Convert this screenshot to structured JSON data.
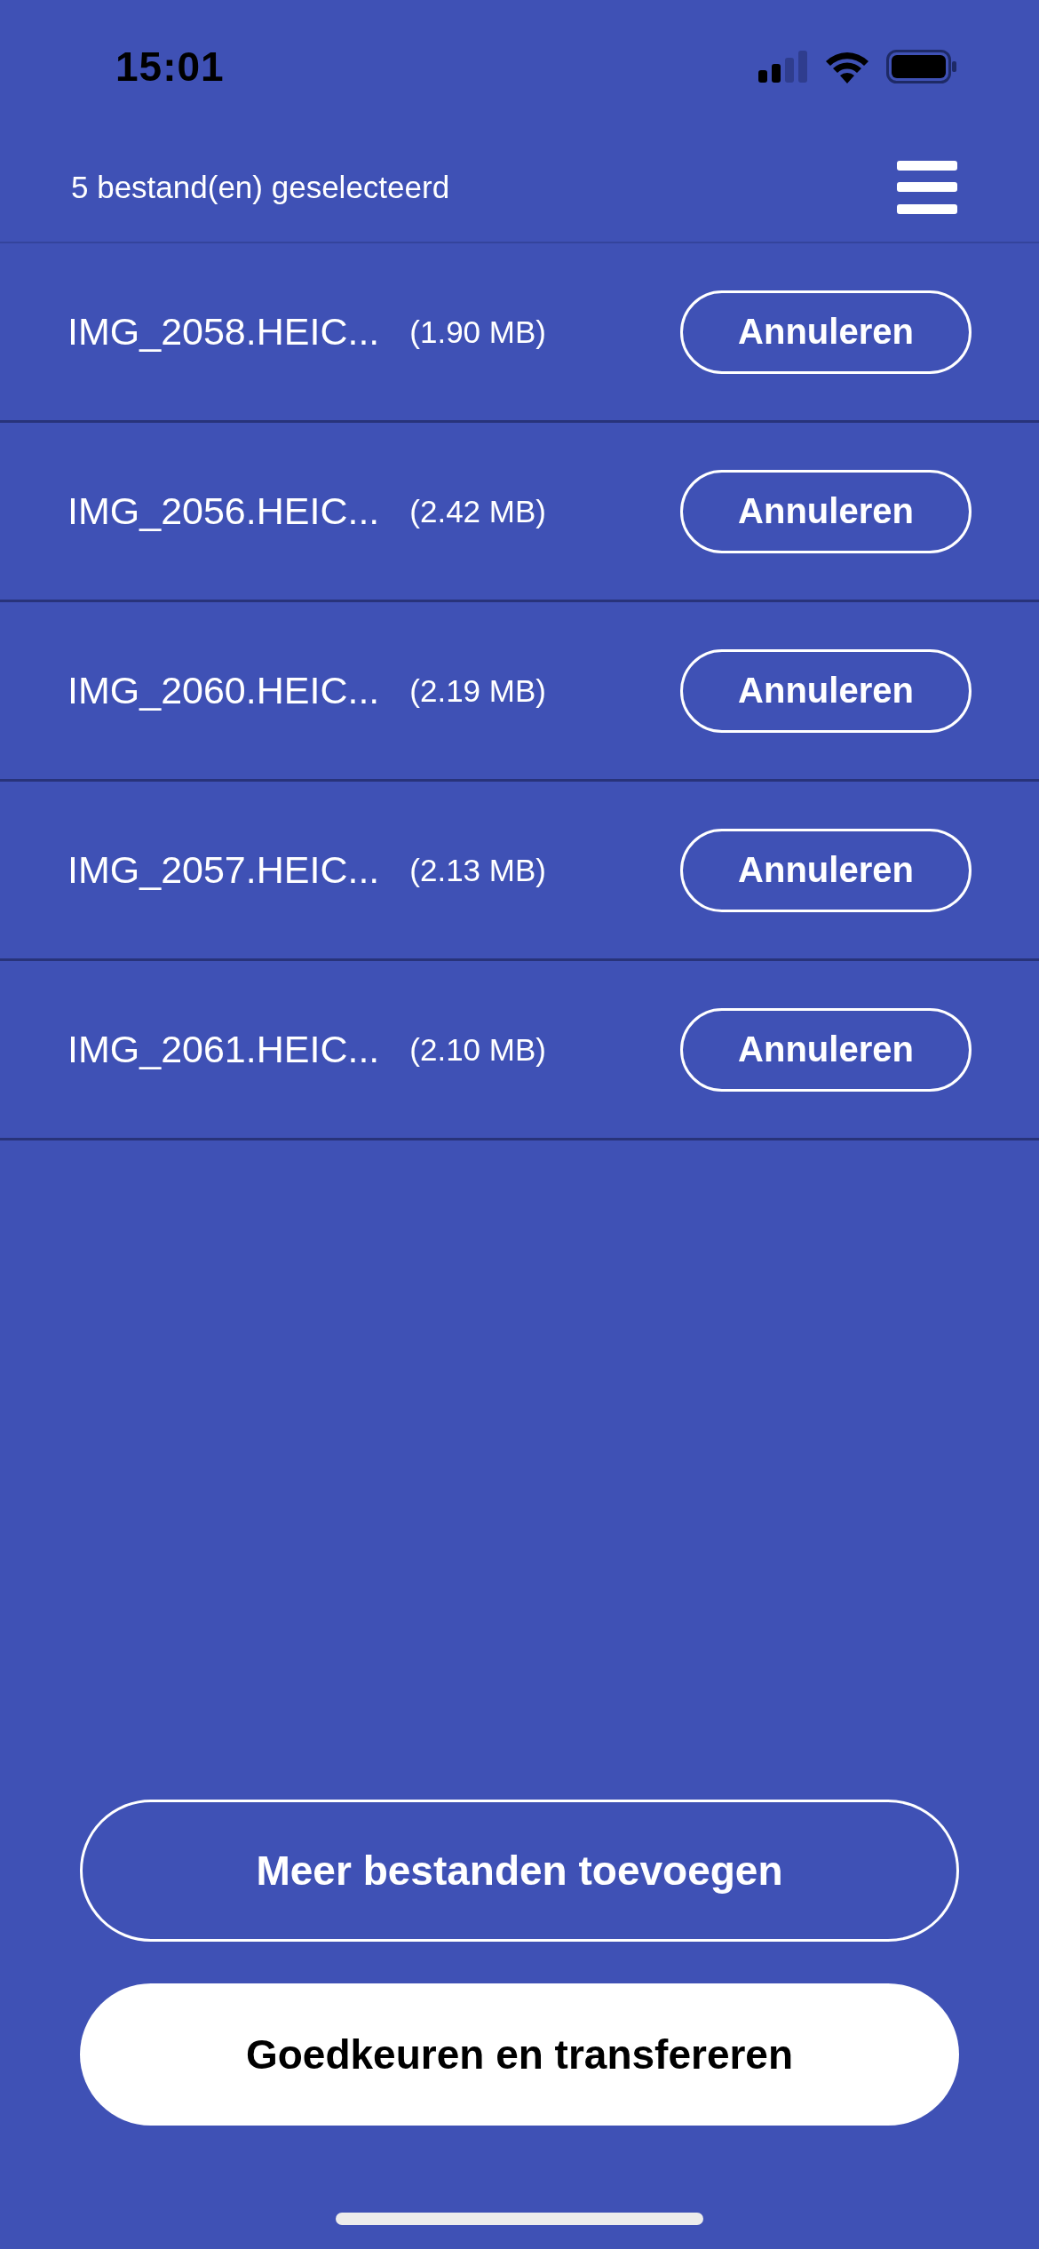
{
  "status_bar": {
    "time": "15:01"
  },
  "header": {
    "title": "5 bestand(en) geselecteerd"
  },
  "files": [
    {
      "name": "IMG_2058.HEIC...",
      "size": "(1.90 MB)",
      "action": "Annuleren"
    },
    {
      "name": "IMG_2056.HEIC...",
      "size": "(2.42 MB)",
      "action": "Annuleren"
    },
    {
      "name": "IMG_2060.HEIC...",
      "size": "(2.19 MB)",
      "action": "Annuleren"
    },
    {
      "name": "IMG_2057.HEIC...",
      "size": "(2.13 MB)",
      "action": "Annuleren"
    },
    {
      "name": "IMG_2061.HEIC...",
      "size": "(2.10 MB)",
      "action": "Annuleren"
    }
  ],
  "buttons": [
    {
      "label": "Meer bestanden toevoegen",
      "kind": "outline"
    },
    {
      "label": "Goedkeuren en transfereren",
      "kind": "filled"
    }
  ]
}
